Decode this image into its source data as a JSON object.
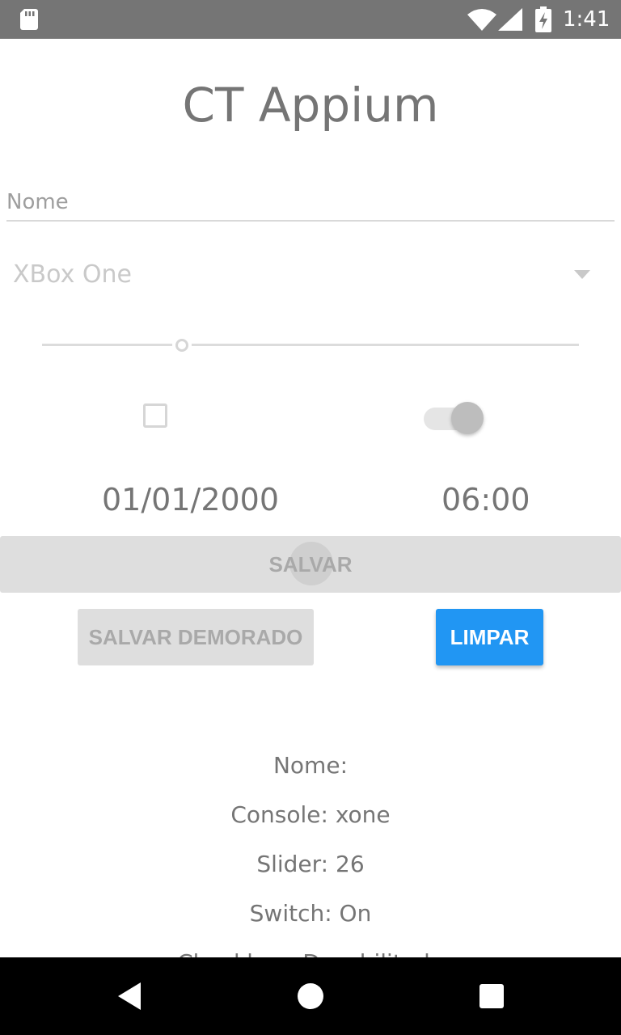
{
  "status_bar": {
    "time": "1:41",
    "icons": [
      "sd-card-icon",
      "wifi-icon",
      "signal-icon",
      "battery-charging-icon"
    ]
  },
  "app": {
    "title": "CT Appium"
  },
  "form": {
    "name_placeholder": "Nome",
    "name_value": "",
    "console_selected": "XBox One",
    "slider_value": 26,
    "checkbox_checked": false,
    "switch_on": true,
    "date": "01/01/2000",
    "time": "06:00"
  },
  "buttons": {
    "save_label": "SALVAR",
    "save_delayed_label": "SALVAR DEMORADO",
    "clear_label": "LIMPAR"
  },
  "results": {
    "name": "Nome:",
    "console": "Console: xone",
    "slider": "Slider: 26",
    "switch": "Switch: On",
    "checkbox_partial": "Checkbox: Desabilitado"
  },
  "nav_bar": {
    "icons": [
      "back-icon",
      "home-icon",
      "recents-icon"
    ]
  },
  "colors": {
    "status_bar": "#757575",
    "accent": "#2196f3",
    "text": "#757575",
    "disabled_button": "#dedede"
  }
}
